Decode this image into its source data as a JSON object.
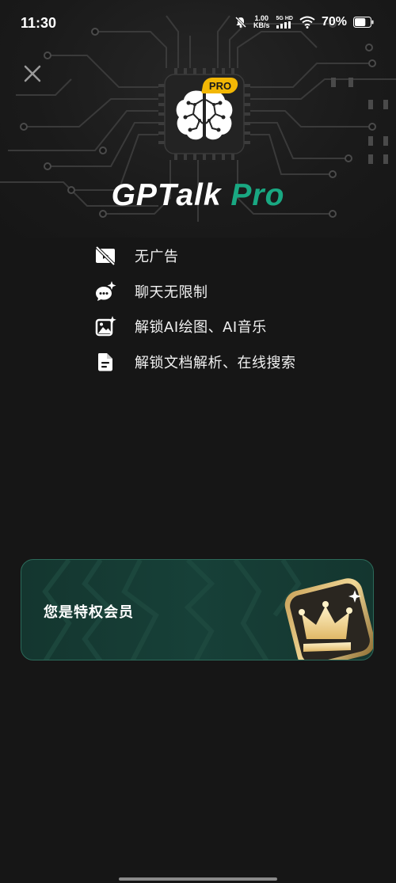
{
  "status_bar": {
    "time": "11:30",
    "net_speed_value": "1.00",
    "net_speed_unit": "KB/s",
    "network_type_top": "5G",
    "network_type_hd": "HD",
    "battery_percent": "70%",
    "battery_level": 0.7
  },
  "brand": {
    "name_main": "GPTalk ",
    "name_accent": "Pro",
    "badge": "PRO",
    "accent_color": "#19a882"
  },
  "features": [
    {
      "icon": "no-ads-icon",
      "label": "无广告"
    },
    {
      "icon": "chat-sparkle-icon",
      "label": "聊天无限制"
    },
    {
      "icon": "image-sparkle-icon",
      "label": "解锁AI绘图、AI音乐"
    },
    {
      "icon": "document-icon",
      "label": "解锁文档解析、在线搜索"
    }
  ],
  "member_card": {
    "label": "您是特权会员",
    "icon": "crown-badge-icon"
  }
}
